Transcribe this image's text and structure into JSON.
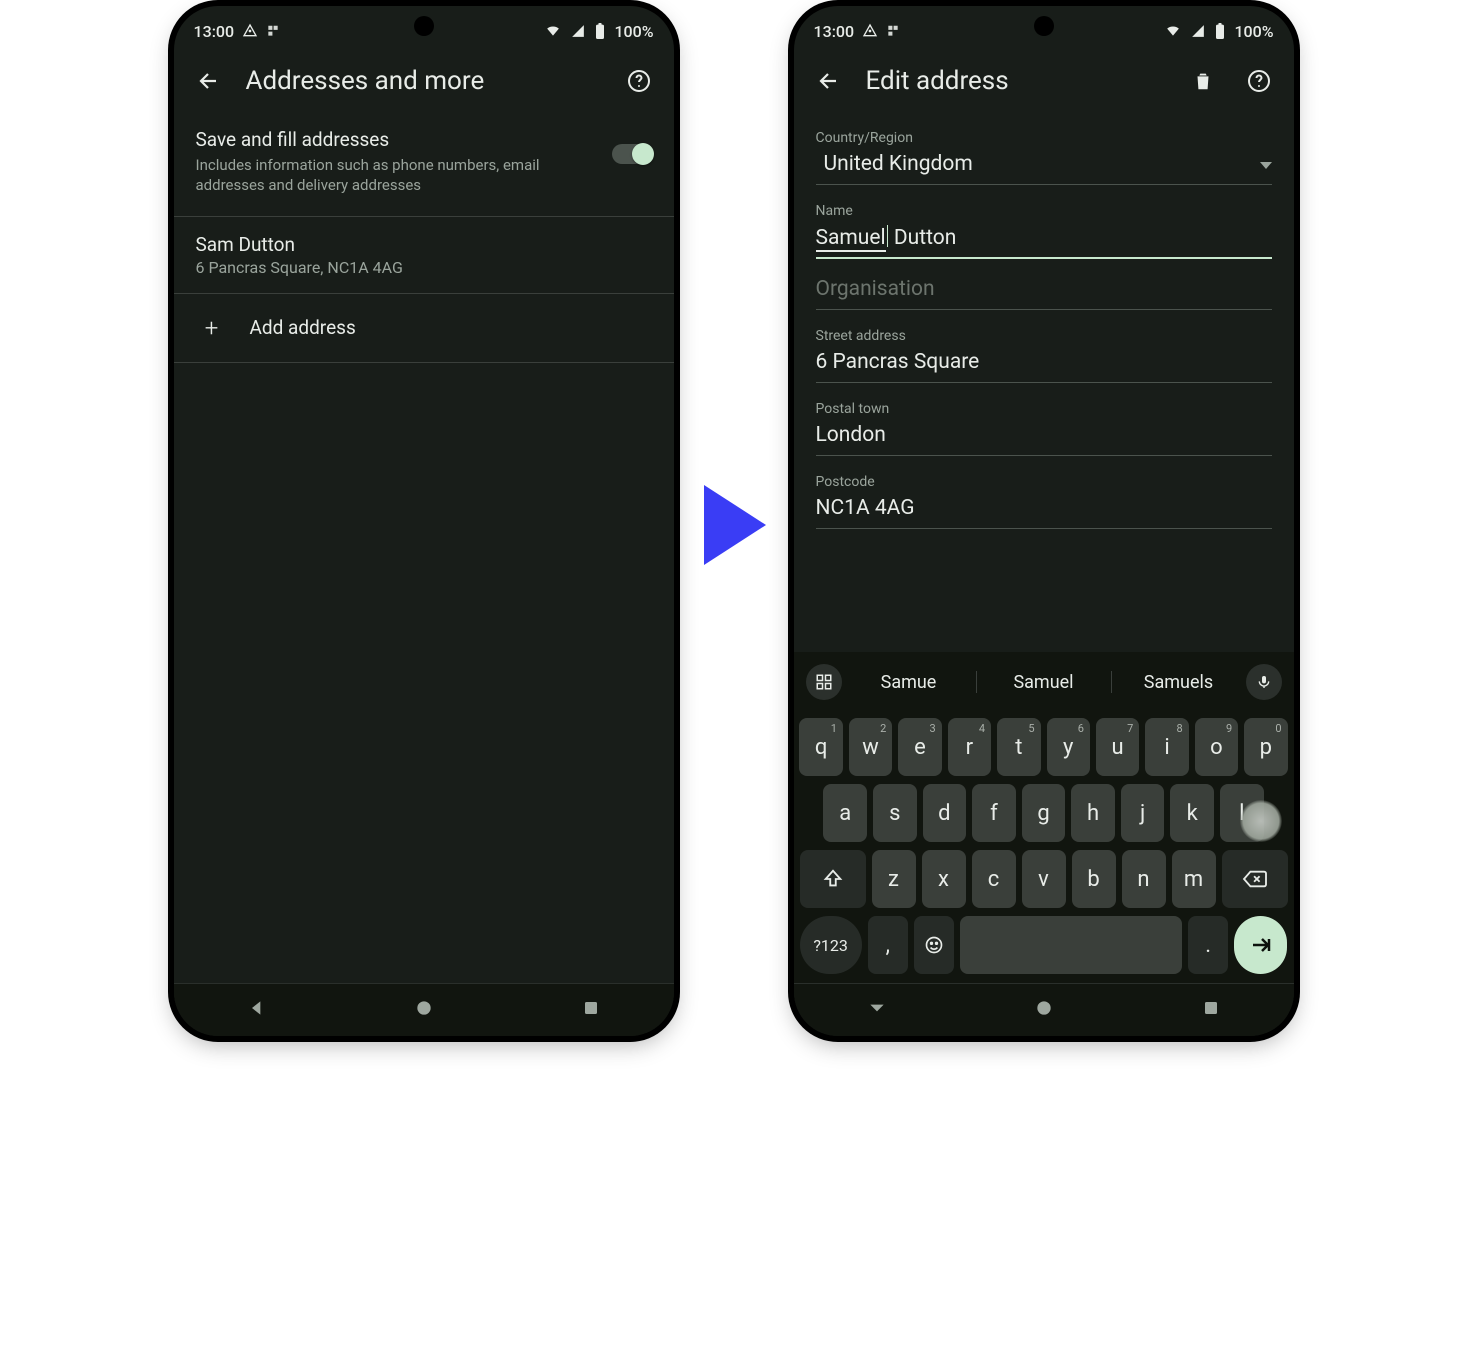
{
  "status": {
    "time": "13:00",
    "battery": "100%"
  },
  "left": {
    "title": "Addresses and more",
    "toggle_title": "Save and fill addresses",
    "toggle_desc": "Includes information such as phone numbers, email addresses and delivery addresses",
    "entry_name": "Sam Dutton",
    "entry_addr": "6 Pancras Square, NC1A 4AG",
    "add_label": "Add address"
  },
  "right": {
    "title": "Edit address",
    "country_label": "Country/Region",
    "country": "United Kingdom",
    "name_label": "Name",
    "name_first": "Samuel",
    "name_rest": "Dutton",
    "org_label": "Organisation",
    "street_label": "Street address",
    "street": "6 Pancras Square",
    "town_label": "Postal town",
    "town": "London",
    "postcode_label": "Postcode",
    "postcode": "NC1A 4AG"
  },
  "keyboard": {
    "suggestions": [
      "Samue",
      "Samuel",
      "Samuels"
    ],
    "row1": [
      "q",
      "w",
      "e",
      "r",
      "t",
      "y",
      "u",
      "i",
      "o",
      "p"
    ],
    "row1sup": [
      "1",
      "2",
      "3",
      "4",
      "5",
      "6",
      "7",
      "8",
      "9",
      "0"
    ],
    "row2": [
      "a",
      "s",
      "d",
      "f",
      "g",
      "h",
      "j",
      "k",
      "l"
    ],
    "row3": [
      "z",
      "x",
      "c",
      "v",
      "b",
      "n",
      "m"
    ],
    "numkey": "?123",
    "comma": ",",
    "period": "."
  }
}
